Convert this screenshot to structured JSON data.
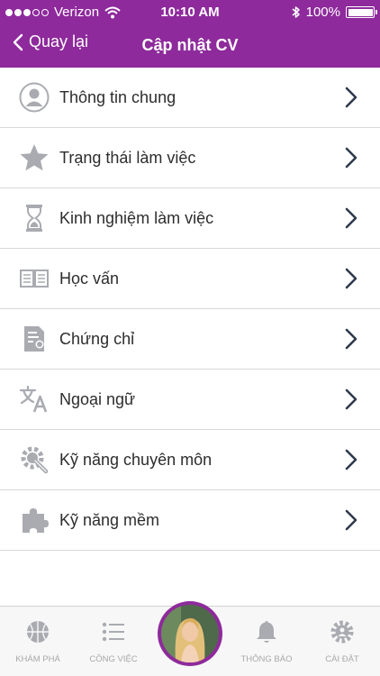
{
  "status_bar": {
    "carrier": "Verizon",
    "time": "10:10 AM",
    "battery": "100%",
    "icons": [
      "signal-dots-icon",
      "wifi-icon",
      "bluetooth-icon",
      "battery-icon"
    ]
  },
  "nav": {
    "back_label": "Quay lại",
    "title": "Cập nhật CV"
  },
  "colors": {
    "brand": "#8e2a9c",
    "icon_gray": "#a9abb1",
    "chevron": "#2f3b4c",
    "tab_label": "#a8a8a8"
  },
  "menu": {
    "items": [
      {
        "label": "Thông tin chung",
        "icon": "user-icon"
      },
      {
        "label": "Trạng thái làm việc",
        "icon": "star-icon"
      },
      {
        "label": "Kinh nghiệm làm việc",
        "icon": "hourglass-icon"
      },
      {
        "label": "Học vấn",
        "icon": "book-icon"
      },
      {
        "label": "Chứng chỉ",
        "icon": "certificate-icon"
      },
      {
        "label": "Ngoại ngữ",
        "icon": "translate-icon"
      },
      {
        "label": "Kỹ năng chuyên môn",
        "icon": "tools-icon"
      },
      {
        "label": "Kỹ năng mềm",
        "icon": "puzzle-icon"
      }
    ]
  },
  "tabbar": {
    "items": [
      {
        "label": "KHÁM PHÁ",
        "icon": "basketball-icon"
      },
      {
        "label": "CÔNG VIỆC",
        "icon": "list-icon"
      },
      {
        "label": "THÔNG BÁO",
        "icon": "bell-icon"
      },
      {
        "label": "CÀI ĐẶT",
        "icon": "settings-icon"
      }
    ],
    "center_icon": "profile-avatar"
  }
}
